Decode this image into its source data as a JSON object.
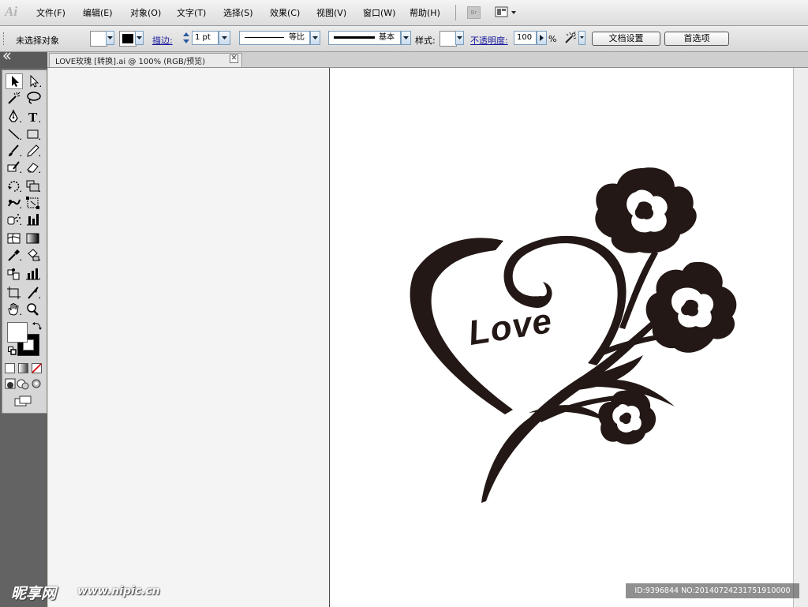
{
  "app": {
    "logo_text": "Ai",
    "bridge_label": "Br"
  },
  "menu": [
    "文件(F)",
    "编辑(E)",
    "对象(O)",
    "文字(T)",
    "选择(S)",
    "效果(C)",
    "视图(V)",
    "窗口(W)",
    "帮助(H)"
  ],
  "control_bar": {
    "selection_status": "未选择对象",
    "stroke_label": "描边:",
    "stroke_weight": "1 pt",
    "variable_width_label": "等比",
    "brush_label": "基本",
    "style_label": "样式:",
    "opacity_label": "不透明度:",
    "opacity_value": "100",
    "opacity_unit": "%",
    "doc_setup_button": "文档设置",
    "preferences_button": "首选项"
  },
  "document": {
    "tab_title": "LOVE玫瑰  [转换].ai @ 100% (RGB/预览)",
    "close_glyph": "✕"
  },
  "artwork": {
    "text": "Love",
    "ink_color": "#231815"
  },
  "watermark": {
    "logo": "昵享网",
    "url": "www.nipic.cn",
    "id": "ID:9396844 NO:20140724231751910000"
  },
  "colors": {
    "fill": "#ffffff",
    "stroke": "#000000"
  },
  "icons": [
    "selection",
    "direct-selection",
    "magic-wand",
    "lasso",
    "pen",
    "type",
    "line",
    "rectangle",
    "paintbrush",
    "pencil",
    "blob-brush",
    "eraser",
    "rotate",
    "scale",
    "warp",
    "free-transform",
    "symbol-sprayer",
    "column-graph",
    "mesh",
    "gradient",
    "eyedropper",
    "live-paint-bucket",
    "slice",
    "hand",
    "zoom"
  ]
}
